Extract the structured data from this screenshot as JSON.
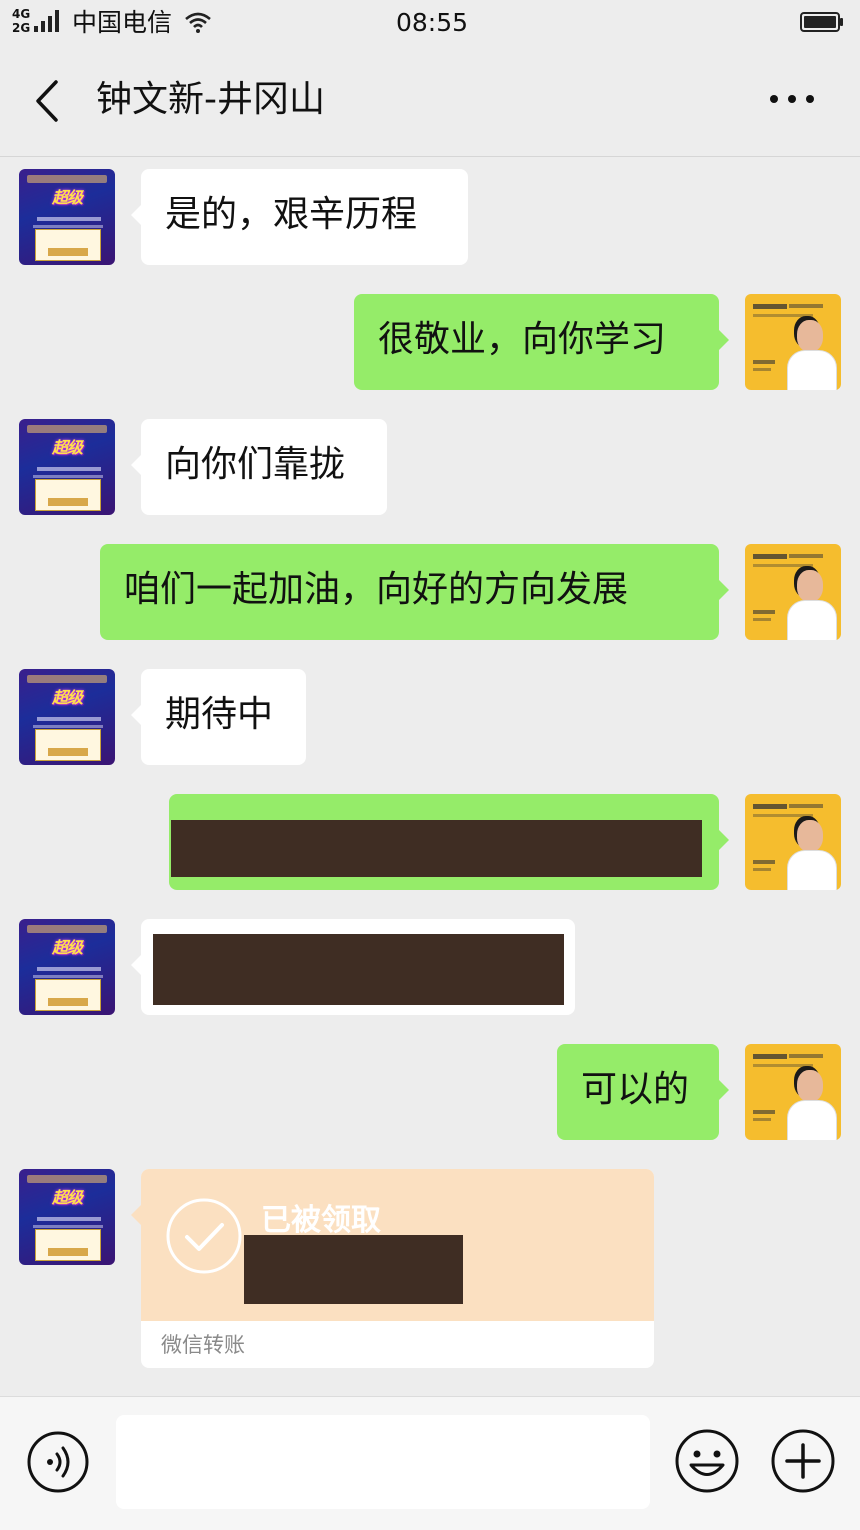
{
  "status_bar": {
    "network_top": "4G",
    "network_bottom": "2G",
    "carrier": "中国电信",
    "time": "08:55",
    "icons": [
      "signal-icon",
      "wifi-icon",
      "battery-icon"
    ]
  },
  "nav": {
    "title": "钟文新-井冈山",
    "icons": [
      "back-chevron-icon",
      "more-dots-icon"
    ]
  },
  "messages": [
    {
      "side": "left",
      "text": "是的，艰辛历程"
    },
    {
      "side": "right",
      "text": "很敬业，向你学习"
    },
    {
      "side": "left",
      "text": "向你们靠拢"
    },
    {
      "side": "right",
      "text": "咱们一起加油，向好的方向发展"
    },
    {
      "side": "left",
      "text": "期待中"
    },
    {
      "side": "right",
      "text": "",
      "redacted": true
    },
    {
      "side": "left",
      "text": "",
      "redacted": true
    },
    {
      "side": "right",
      "text": "可以的"
    }
  ],
  "transfer": {
    "status": "已被领取",
    "footer": "微信转账",
    "amount_redacted": true
  },
  "input_bar": {
    "icons": [
      "voice-icon",
      "emoji-icon",
      "plus-icon"
    ]
  },
  "colors": {
    "background": "#ededed",
    "bubble_self": "#95ec69",
    "bubble_other": "#ffffff",
    "transfer_card": "#fbe0c1",
    "redaction": "#3f2d23"
  }
}
